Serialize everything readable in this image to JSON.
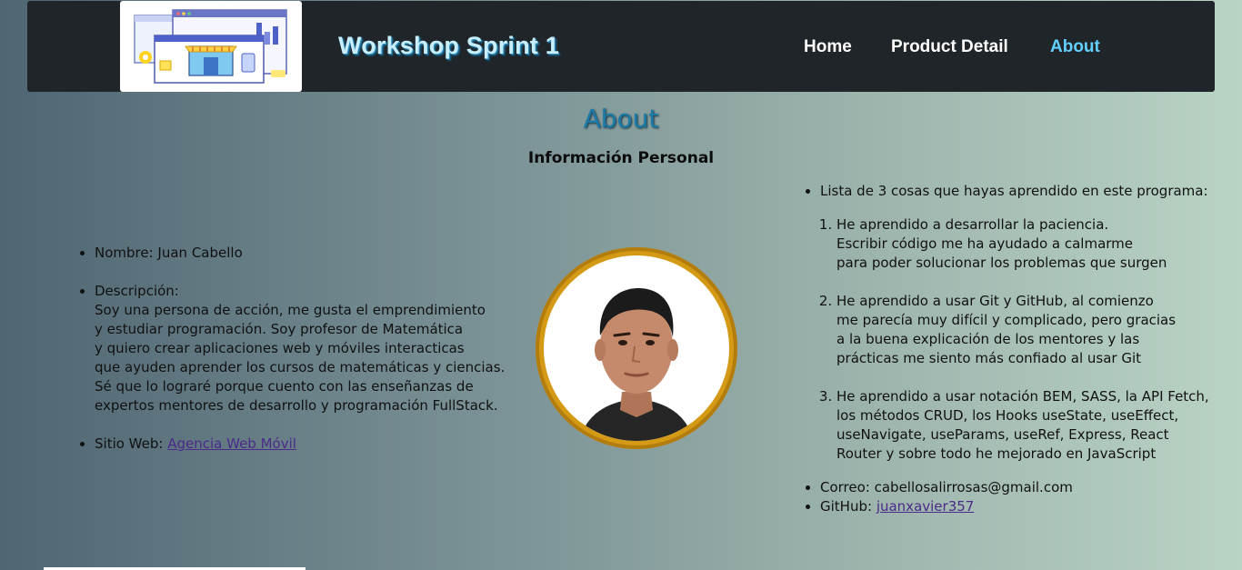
{
  "header": {
    "brand": "Workshop Sprint 1",
    "nav": [
      {
        "label": "Home"
      },
      {
        "label": "Product Detail"
      },
      {
        "label": "About"
      }
    ]
  },
  "main": {
    "title": "About",
    "subtitle": "Información Personal",
    "left": {
      "nombre": "Nombre: Juan Cabello",
      "descripcion_label": "Descripción:",
      "descripcion_lines": [
        "Soy una persona de acción, me gusta el emprendimiento",
        "y estudiar programación. Soy profesor de Matemática",
        "y quiero crear aplicaciones web y móviles interacticas",
        "que ayuden aprender los cursos de matemáticas y ciencias.",
        "Sé que lo lograré porque cuento con las enseñanzas de",
        "expertos mentores de desarrollo y programación FullStack."
      ],
      "sitio_label": "Sitio Web: ",
      "sitio_link": "Agencia Web Móvil"
    },
    "right": {
      "intro": "Lista de 3 cosas que hayas aprendido en este programa:",
      "items": [
        [
          "He aprendido a desarrollar la paciencia.",
          "Escribir código me ha ayudado a calmarme",
          "para poder solucionar los problemas que surgen"
        ],
        [
          "He aprendido a usar Git y GitHub, al comienzo",
          "me parecía muy difícil y complicado, pero gracias",
          "a la buena explicación de los mentores y las",
          "prácticas me siento más confiado al usar Git"
        ],
        [
          "He aprendido a usar notación BEM, SASS, la API Fetch,",
          "los métodos CRUD, los Hooks useState, useEffect,",
          "useNavigate, useParams, useRef, Express, React",
          "Router y sobre todo he mejorado en JavaScript"
        ]
      ],
      "correo": "Correo: cabellosalirrosas@gmail.com",
      "github_label": "GitHub: ",
      "github_link": "juanxavier357"
    }
  },
  "colors": {
    "navbar_bg": "#1f2528",
    "active_link": "#62cfff",
    "title": "#1c7aa6",
    "avatar_ring": "#d49a16",
    "link": "#4b2a8a"
  }
}
